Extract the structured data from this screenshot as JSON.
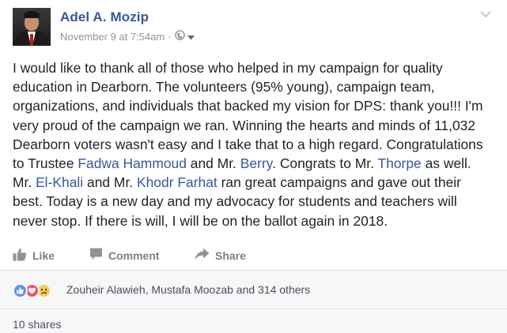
{
  "post": {
    "author": "Adel A. Mozip",
    "timestamp": "November 9 at 7:54am",
    "audience_icon": "globe-icon",
    "text_lines": [
      [
        {
          "t": "I would like to thank all of those who helped in my campaign for quality"
        }
      ],
      [
        {
          "t": "education in Dearborn. The volunteers (95% young), campaign team,"
        }
      ],
      [
        {
          "t": "organizations, and individuals that backed my vision for DPS: thank you!!! I'm"
        }
      ],
      [
        {
          "t": "very proud of the campaign we ran. Winning the hearts and minds of 11,032"
        }
      ],
      [
        {
          "t": "Dearborn voters wasn't easy and I take that to a high regard. Congratulations"
        }
      ],
      [
        {
          "t": "to Trustee "
        },
        {
          "t": "Fadwa Hammoud",
          "link": true
        },
        {
          "t": " and Mr. "
        },
        {
          "t": "Berry",
          "link": true
        },
        {
          "t": ". Congrats to Mr. "
        },
        {
          "t": "Thorpe",
          "link": true
        },
        {
          "t": " as well."
        }
      ],
      [
        {
          "t": "Mr. "
        },
        {
          "t": "El-Khali",
          "link": true
        },
        {
          "t": " and Mr. "
        },
        {
          "t": "Khodr Farhat",
          "link": true
        },
        {
          "t": " ran great campaigns and gave out their"
        }
      ],
      [
        {
          "t": "best. Today is a new day and my advocacy for students and teachers will"
        }
      ],
      [
        {
          "t": "never stop. If there is will, I will be on the ballot again in 2018."
        }
      ]
    ]
  },
  "actions": {
    "like_label": "Like",
    "comment_label": "Comment",
    "share_label": "Share"
  },
  "reactions": {
    "icons": [
      "like-icon",
      "love-icon",
      "sad-icon"
    ],
    "names": "Zouheir Alawieh, Mustafa Moozab and 314 others"
  },
  "shares": {
    "label": "10 shares"
  },
  "colors": {
    "link": "#365899",
    "text": "#1d2129",
    "meta": "#90949c",
    "action": "#7f7f7f",
    "like": "#5890ff",
    "love": "#f25268",
    "sad": "#f7cf4a"
  }
}
